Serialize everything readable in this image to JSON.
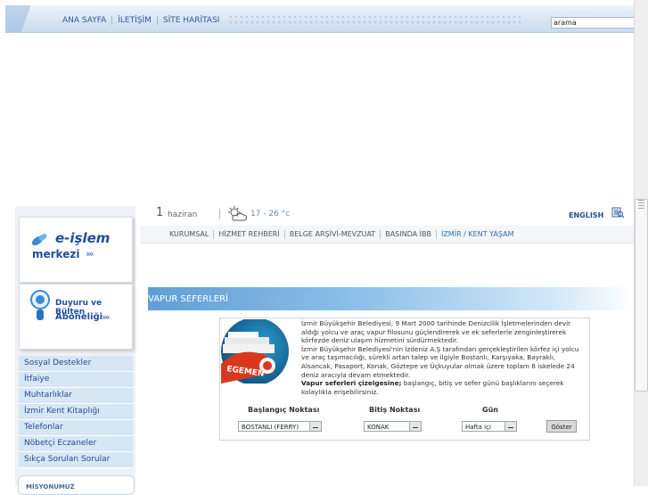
{
  "topnav": {
    "items": [
      "ANA SAYFA",
      "İLETİŞİM",
      "SİTE HARİTASI"
    ]
  },
  "search": {
    "value": "arama"
  },
  "leftcol": {
    "eislem": {
      "title_main": "e-işlem",
      "title_sub": "merkezi",
      "arrow": "›››"
    },
    "duyuru": {
      "line1": "Duyuru ve Bülten",
      "line2": "Aboneliği",
      "arrow": "›››"
    },
    "menu": [
      "Sosyal Destekler",
      "İtfaiye",
      "Muhtarlıklar",
      "İzmir Kent Kitaplığı",
      "Telefonlar",
      "Nöbetçi Eczaneler",
      "Sıkça Sorulan Sorular"
    ],
    "misyon": "MİSYONUMUZ"
  },
  "infobar": {
    "day": "1",
    "month": "haziran",
    "temperature": "17 - 26 °c",
    "language": "ENGLISH"
  },
  "mainnav": {
    "items": [
      "KURUMSAL",
      "HİZMET REHBERİ",
      "BELGE ARŞİVİ-MEVZUAT",
      "BASINDA İBB",
      "İZMİR / KENT YAŞAM"
    ]
  },
  "page": {
    "title": "VAPUR SEFERLERİ"
  },
  "content": {
    "para1": "İzmir Büyükşehir Belediyesi, 9 Mart 2000 tarihinde Denizcilik İşletmelerinden devir aldığı yolcu ve araç vapur filosunu güçlendirerek ve ek seferlerle zenginleştirerek körfezde deniz ulaşım hizmetini sürdürmektedir.",
    "para2": "İzmir Büyükşehir Belediyesi'nin İzdeniz A.Ş tarafından gerçekleştirilen körfez içi yolcu ve araç taşımacılığı, sürekli artan talep ve ilgiyle Bostanlı, Karşıyaka, Bayraklı, Alsancak, Pasaport, Konak, Göztepe ve Üçkuyular olmak üzere toplam 8 iskelede 24 deniz aracıyla devam etmektedir.",
    "para3_bold": "Vapur seferleri çizelgesine;",
    "para3_rest": " başlangıç, bitiş ve sefer günü başlıklarını seçerek kolaylıkla erişebilirsiniz.",
    "image_text": "EGEMEN"
  },
  "form": {
    "start_label": "Başlangıç Noktası",
    "end_label": "Bitiş Noktası",
    "day_label": "Gün",
    "start_value": "BOSTANLI (FERRY)",
    "end_value": "KONAK",
    "day_value": "Hafta içi",
    "button_label": "Göster"
  },
  "colors": {
    "accent": "#1f4e9a",
    "menu_bg": "#d7e6f5",
    "header_blue": "#5f9fd6"
  }
}
